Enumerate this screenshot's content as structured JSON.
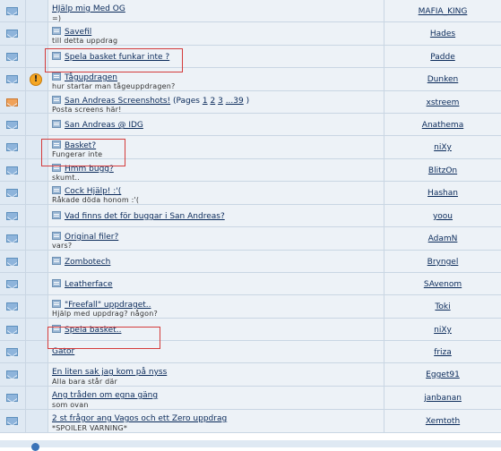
{
  "topics": [
    {
      "title": "HJälp mig Med OG",
      "sub": "=)",
      "author": "MAFIA_KING",
      "icon": "mail-icon",
      "status": "",
      "has_doc": false
    },
    {
      "title": "Savefil",
      "sub": "till detta uppdrag",
      "author": "Hades",
      "icon": "mail-icon",
      "status": "",
      "has_doc": true
    },
    {
      "title": "Spela basket funkar inte ?",
      "sub": "",
      "author": "Padde",
      "icon": "mail-icon",
      "status": "",
      "has_doc": true
    },
    {
      "title": "Tågupdragen",
      "sub": "hur startar man tågeuppdragen?",
      "author": "Dunken",
      "icon": "mail-icon",
      "status": "!",
      "has_doc": true
    },
    {
      "title": "San Andreas Screenshots!",
      "pages_prefix": " (Pages ",
      "pages": [
        "1",
        "2",
        "3",
        "...39"
      ],
      "pages_suffix": " )",
      "sub": "Posta screens här!",
      "author": "xstreem",
      "icon": "mail-hot-icon",
      "status": "",
      "has_doc": true
    },
    {
      "title": "San Andreas @ IDG",
      "sub": "",
      "author": "Anathema",
      "icon": "mail-icon",
      "status": "",
      "has_doc": true
    },
    {
      "title": "Basket?",
      "sub": "Fungerar inte",
      "author": "niXy",
      "icon": "mail-icon",
      "status": "",
      "has_doc": true
    },
    {
      "title": "Hmm bugg?",
      "sub": "skumt..",
      "author": "BlitzOn",
      "icon": "mail-icon",
      "status": "",
      "has_doc": true
    },
    {
      "title": "Cock Hjälp! :'(",
      "sub": "Råkade döda honom :'(",
      "author": "Hashan",
      "icon": "mail-icon",
      "status": "",
      "has_doc": true
    },
    {
      "title": "Vad finns det för buggar i San Andreas?",
      "sub": "",
      "author": "yoou",
      "icon": "mail-icon",
      "status": "",
      "has_doc": true
    },
    {
      "title": "Original filer?",
      "sub": "vars?",
      "author": "AdamN",
      "icon": "mail-icon",
      "status": "",
      "has_doc": true
    },
    {
      "title": "Zombotech",
      "sub": "",
      "author": "Bryngel",
      "icon": "mail-icon",
      "status": "",
      "has_doc": true
    },
    {
      "title": "Leatherface",
      "sub": "",
      "author": "SAvenom",
      "icon": "mail-icon",
      "status": "",
      "has_doc": true
    },
    {
      "title": "\"Freefall\" uppdraget..",
      "sub": "Hjälp med uppdrag? någon?",
      "author": "Toki",
      "icon": "mail-icon",
      "status": "",
      "has_doc": true
    },
    {
      "title": "Spela basket..",
      "sub": "",
      "author": "niXy",
      "icon": "mail-icon",
      "status": "",
      "has_doc": true
    },
    {
      "title": "Gator",
      "sub": "",
      "author": "friza",
      "icon": "mail-icon",
      "status": "",
      "has_doc": false
    },
    {
      "title": "En liten sak jag kom på nyss",
      "sub": "Alla bara står där",
      "author": "Egget91",
      "icon": "mail-icon",
      "status": "",
      "has_doc": false
    },
    {
      "title": "Ang tråden om egna gäng",
      "sub": "som ovan",
      "author": "janbanan",
      "icon": "mail-icon",
      "status": "",
      "has_doc": false
    },
    {
      "title": "2 st frågor ang Vagos och ett Zero uppdrag",
      "sub": "*SPOILER VARNING*",
      "author": "Xemtoth",
      "icon": "mail-icon",
      "status": "",
      "has_doc": false
    }
  ],
  "highlighted_rows": [
    2,
    6,
    14
  ]
}
